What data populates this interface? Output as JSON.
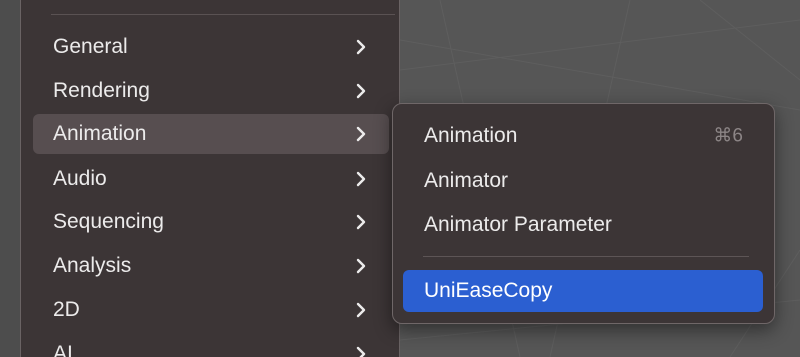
{
  "main_menu": {
    "items": [
      {
        "label": "General",
        "has_submenu": true,
        "active": false
      },
      {
        "label": "Rendering",
        "has_submenu": true,
        "active": false
      },
      {
        "label": "Animation",
        "has_submenu": true,
        "active": true
      },
      {
        "label": "Audio",
        "has_submenu": true,
        "active": false
      },
      {
        "label": "Sequencing",
        "has_submenu": true,
        "active": false
      },
      {
        "label": "Analysis",
        "has_submenu": true,
        "active": false
      },
      {
        "label": "2D",
        "has_submenu": true,
        "active": false
      },
      {
        "label": "AI",
        "has_submenu": true,
        "active": false
      }
    ]
  },
  "submenu": {
    "items": [
      {
        "label": "Animation",
        "shortcut": "⌘6"
      },
      {
        "label": "Animator",
        "shortcut": ""
      },
      {
        "label": "Animator Parameter",
        "shortcut": ""
      },
      {
        "label": "UniEaseCopy",
        "shortcut": "",
        "selected": true
      }
    ]
  },
  "colors": {
    "menu_background": "#3c3536",
    "active_item": "#574e50",
    "selection_blue": "#2b5fd1",
    "text": "#ecebeb",
    "shortcut_text": "#8c8586"
  },
  "icons": {
    "submenu_indicator": "chevron-right-icon"
  }
}
